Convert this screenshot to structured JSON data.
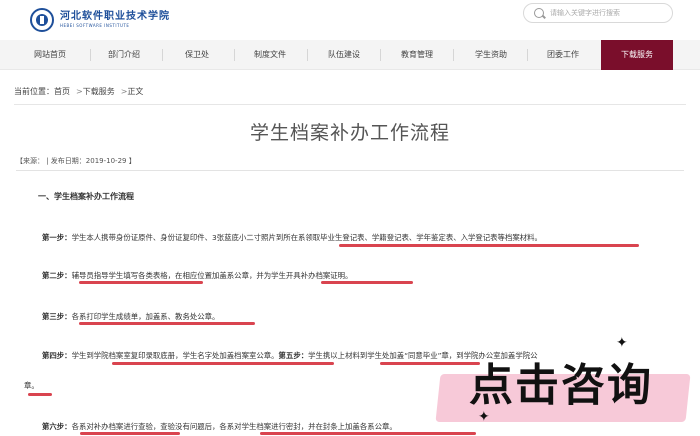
{
  "header": {
    "logo_cn": "河北软件职业技术学院",
    "logo_en": "HEBEI SOFTWARE INSTITUTE",
    "search_placeholder": "请输入关键字进行搜索"
  },
  "nav": {
    "items": [
      "网站首页",
      "部门介绍",
      "保卫处",
      "制度文件",
      "队伍建设",
      "教育管理",
      "学生资助",
      "团委工作",
      "下载服务"
    ],
    "active_index": 8,
    "active_color": "#7a0e2b"
  },
  "breadcrumb": {
    "prefix": "当前位置：",
    "items": [
      "首页",
      "下载服务",
      "正文"
    ],
    "separator": ">"
  },
  "article": {
    "title": "学生档案补办工作流程",
    "meta": "【来源：  | 发布日期：2019-10-29 】",
    "section_heading": "一、学生档案补办工作流程",
    "steps": [
      {
        "label": "第一步：",
        "text": "学生本人携带身份证原件、身份证复印件、3张蓝底小二寸照片到所在系领取毕业生登记表、学籍登记表、学年鉴定表、入学登记表等档案材料。"
      },
      {
        "label": "第二步：",
        "text": "辅导员指导学生填写各类表格，在相应位置加盖系公章，并为学生开具补办档案证明。"
      },
      {
        "label": "第三步：",
        "text": "各系打印学生成绩单，加盖系、教务处公章。"
      },
      {
        "label": "第四步：",
        "text": "学生到学院档案室复印录取底册，学生名字处加盖档案室公章。",
        "label2": "第五步：",
        "text2": "学生携以上材料到学生处加盖“同意毕业”章，到学院办公室加盖学院公",
        "text3": "章。"
      },
      {
        "label": "第六步：",
        "text": "各系对补办档案进行查验，查验没有问题后，各系对学生档案进行密封，并在封条上加盖各系公章。"
      }
    ]
  },
  "promo": {
    "text": "点击咨询",
    "bg_color": "#f7c9d8",
    "sparkle_icon": "✦"
  },
  "colors": {
    "underline": "#d9444f",
    "logo": "#1e4f9a"
  }
}
